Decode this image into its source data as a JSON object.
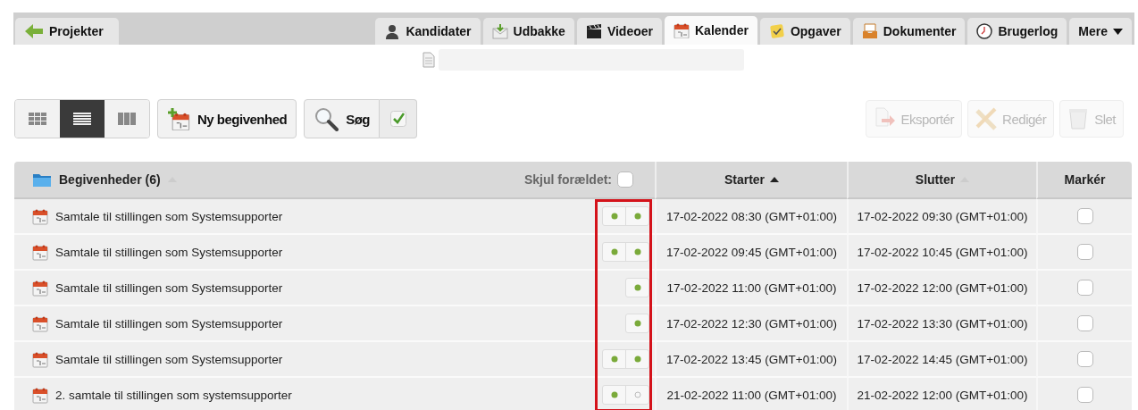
{
  "nav": {
    "back": {
      "label": "Projekter"
    },
    "tabs": [
      {
        "label": "Kandidater",
        "kind": "tab",
        "selected": false
      },
      {
        "label": "Udbakke",
        "kind": "tab",
        "selected": false
      },
      {
        "label": "Videoer",
        "kind": "tab",
        "selected": false
      },
      {
        "label": "Kalender",
        "kind": "tab",
        "selected": true
      },
      {
        "label": "Opgaver",
        "kind": "tab",
        "selected": false
      },
      {
        "label": "Dokumenter",
        "kind": "tab",
        "selected": false
      },
      {
        "label": "Brugerlog",
        "kind": "tab",
        "selected": false
      },
      {
        "label": "Mere",
        "kind": "menu",
        "selected": false
      }
    ]
  },
  "toolbar": {
    "views": [
      {
        "selected": false
      },
      {
        "selected": true
      },
      {
        "selected": false
      }
    ],
    "new_event": {
      "label": "Ny begivenhed"
    },
    "search": {
      "label": "Søg"
    },
    "actions": [
      {
        "label": "Eksportér",
        "disabled": true
      },
      {
        "label": "Redigér",
        "disabled": true
      },
      {
        "label": "Slet",
        "disabled": true
      }
    ]
  },
  "table": {
    "title": "Begivenheder (6)",
    "hide_past": {
      "label": "Skjul forældet:",
      "checked": false
    },
    "columns": [
      {
        "label": "Starter",
        "sorted": true
      },
      {
        "label": "Slutter",
        "sorted": false
      },
      {
        "label": "Markér"
      }
    ],
    "rows": [
      {
        "title": "Samtale til stillingen som Systemsupporter",
        "dots": [
          {
            "filled": true
          },
          {
            "filled": true
          }
        ],
        "start": "17-02-2022 08:30 (GMT+01:00)",
        "end": "17-02-2022 09:30 (GMT+01:00)",
        "checked": false
      },
      {
        "title": "Samtale til stillingen som Systemsupporter",
        "dots": [
          {
            "filled": true
          },
          {
            "filled": true
          }
        ],
        "start": "17-02-2022 09:45 (GMT+01:00)",
        "end": "17-02-2022 10:45 (GMT+01:00)",
        "checked": false
      },
      {
        "title": "Samtale til stillingen som Systemsupporter",
        "dots": [
          {
            "filled": true
          }
        ],
        "start": "17-02-2022 11:00 (GMT+01:00)",
        "end": "17-02-2022 12:00 (GMT+01:00)",
        "checked": false
      },
      {
        "title": "Samtale til stillingen som Systemsupporter",
        "dots": [
          {
            "filled": true
          }
        ],
        "start": "17-02-2022 12:30 (GMT+01:00)",
        "end": "17-02-2022 13:30 (GMT+01:00)",
        "checked": false
      },
      {
        "title": "Samtale til stillingen som Systemsupporter",
        "dots": [
          {
            "filled": true
          },
          {
            "filled": true
          }
        ],
        "start": "17-02-2022 13:45 (GMT+01:00)",
        "end": "17-02-2022 14:45 (GMT+01:00)",
        "checked": false
      },
      {
        "title": "2. samtale til stillingen som systemsupporter",
        "dots": [
          {
            "filled": true
          },
          {
            "filled": false
          }
        ],
        "start": "21-02-2022 11:00 (GMT+01:00)",
        "end": "21-02-2022 12:00 (GMT+01:00)",
        "checked": false
      }
    ]
  }
}
